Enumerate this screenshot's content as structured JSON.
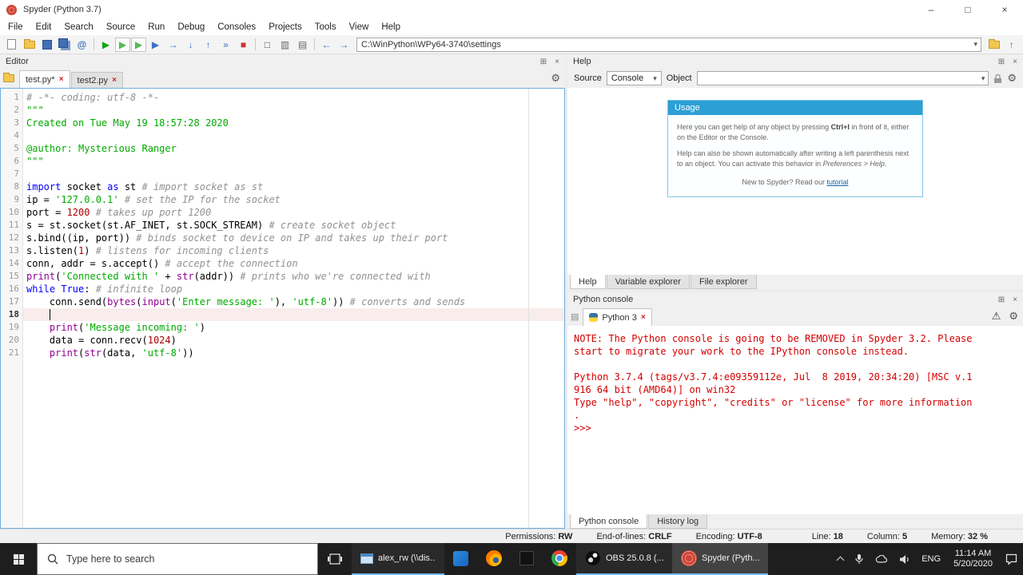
{
  "window": {
    "title": "Spyder (Python 3.7)",
    "controls": {
      "minimize": "–",
      "maximize": "□",
      "close": "×"
    }
  },
  "menu": [
    "File",
    "Edit",
    "Search",
    "Source",
    "Run",
    "Debug",
    "Consoles",
    "Projects",
    "Tools",
    "View",
    "Help"
  ],
  "toolbar": {
    "buttons": [
      {
        "name": "new-file-button",
        "icon": "new-file-icon",
        "cls": "ic-page"
      },
      {
        "name": "open-file-button",
        "icon": "open-folder-icon",
        "cls": "ic-folder"
      },
      {
        "name": "save-button",
        "icon": "save-icon",
        "cls": "ic-save"
      },
      {
        "name": "save-all-button",
        "icon": "save-all-icon",
        "cls": "ic-save ic-save2"
      },
      {
        "name": "find-symbols-button",
        "icon": "at-icon",
        "glyph": "@",
        "color": "#2d6fb5",
        "bold": true
      },
      {
        "sep": true
      },
      {
        "name": "run-file-button",
        "icon": "run-icon",
        "glyph": "▶",
        "color": "#13a813"
      },
      {
        "name": "run-cell-button",
        "icon": "run-cell-icon",
        "glyph": "▶",
        "color": "#55b855",
        "boxed": true
      },
      {
        "name": "run-cell-advance-button",
        "icon": "run-cell-advance-icon",
        "glyph": "▶",
        "color": "#55b855",
        "boxed": true
      },
      {
        "name": "debug-button",
        "icon": "debug-icon",
        "glyph": "▶",
        "color": "#3d70c9"
      },
      {
        "name": "step-over-button",
        "icon": "step-over-icon",
        "glyph": "→",
        "color": "#3d70c9"
      },
      {
        "name": "step-into-button",
        "icon": "step-into-icon",
        "glyph": "↓",
        "color": "#3d70c9"
      },
      {
        "name": "step-return-button",
        "icon": "step-return-icon",
        "glyph": "↑",
        "color": "#3d70c9"
      },
      {
        "name": "continue-button",
        "icon": "continue-icon",
        "glyph": "»",
        "color": "#3d70c9"
      },
      {
        "name": "stop-button",
        "icon": "stop-icon",
        "glyph": "■",
        "color": "#cc3333"
      },
      {
        "sep": true
      },
      {
        "name": "maximize-pane-button",
        "icon": "maximize-pane-icon",
        "glyph": "□",
        "color": "#555555"
      },
      {
        "name": "split-vertical-button",
        "icon": "split-vertical-icon",
        "glyph": "▥",
        "color": "#666666"
      },
      {
        "name": "split-horizontal-button",
        "icon": "split-horizontal-icon",
        "glyph": "▤",
        "color": "#666666"
      },
      {
        "sep": true
      },
      {
        "name": "back-button",
        "icon": "back-arrow-icon",
        "glyph": "←",
        "color": "#2d6fb5"
      },
      {
        "name": "forward-button",
        "icon": "forward-arrow-icon",
        "glyph": "→",
        "color": "#2d6fb5"
      }
    ],
    "path_value": "C:\\WinPython\\WPy64-3740\\settings",
    "right_buttons": [
      {
        "name": "browse-directory-button",
        "icon": "folder-icon",
        "cls": "ic-folder"
      },
      {
        "name": "parent-directory-button",
        "icon": "folder-up-icon",
        "glyph": "↑",
        "color": "#666666"
      }
    ]
  },
  "editor": {
    "pane_title": "Editor",
    "tabs": [
      {
        "label": "test.py*",
        "active": true
      },
      {
        "label": "test2.py",
        "active": false
      }
    ],
    "cursor": {
      "line": 18,
      "col": 4
    },
    "lines": [
      [
        [
          "c",
          "# -*- coding: utf-8 -*-"
        ]
      ],
      [
        [
          "s",
          "\"\"\""
        ]
      ],
      [
        [
          "s",
          "Created on Tue May 19 18:57:28 2020"
        ]
      ],
      [],
      [
        [
          "s",
          "@author: Mysterious Ranger"
        ]
      ],
      [
        [
          "s",
          "\"\"\""
        ]
      ],
      [],
      [
        [
          "k",
          "import"
        ],
        [
          "t",
          " socket "
        ],
        [
          "k",
          "as"
        ],
        [
          "t",
          " st "
        ],
        [
          "c",
          "# import socket as st"
        ]
      ],
      [
        [
          "t",
          "ip = "
        ],
        [
          "s",
          "'127.0.0.1'"
        ],
        [
          "t",
          " "
        ],
        [
          "c",
          "# set the IP for the socket"
        ]
      ],
      [
        [
          "t",
          "port = "
        ],
        [
          "n",
          "1200"
        ],
        [
          "t",
          " "
        ],
        [
          "c",
          "# takes up port 1200"
        ]
      ],
      [
        [
          "t",
          "s = st.socket(st.AF_INET, st.SOCK_STREAM) "
        ],
        [
          "c",
          "# create socket object"
        ]
      ],
      [
        [
          "t",
          "s.bind((ip, port)) "
        ],
        [
          "c",
          "# binds socket to device on IP and takes up their port"
        ]
      ],
      [
        [
          "t",
          "s.listen("
        ],
        [
          "n",
          "1"
        ],
        [
          "t",
          ") "
        ],
        [
          "c",
          "# listens for incoming clients"
        ]
      ],
      [
        [
          "t",
          "conn, addr = s.accept() "
        ],
        [
          "c",
          "# accept the connection"
        ]
      ],
      [
        [
          "b",
          "print"
        ],
        [
          "t",
          "("
        ],
        [
          "s",
          "'Connected with '"
        ],
        [
          "t",
          " + "
        ],
        [
          "b",
          "str"
        ],
        [
          "t",
          "(addr)) "
        ],
        [
          "c",
          "# prints who we're connected with"
        ]
      ],
      [
        [
          "k",
          "while"
        ],
        [
          "t",
          " "
        ],
        [
          "k",
          "True"
        ],
        [
          "t",
          ": "
        ],
        [
          "c",
          "# infinite loop"
        ]
      ],
      [
        [
          "t",
          "    conn.send("
        ],
        [
          "b",
          "bytes"
        ],
        [
          "t",
          "("
        ],
        [
          "b",
          "input"
        ],
        [
          "t",
          "("
        ],
        [
          "s",
          "'Enter message: '"
        ],
        [
          "t",
          "), "
        ],
        [
          "s",
          "'utf-8'"
        ],
        [
          "t",
          ")) "
        ],
        [
          "c",
          "# converts and sends"
        ]
      ],
      [
        [
          "t",
          "    "
        ]
      ],
      [
        [
          "t",
          "    "
        ],
        [
          "b",
          "print"
        ],
        [
          "t",
          "("
        ],
        [
          "s",
          "'Message incoming: '"
        ],
        [
          "t",
          ")"
        ]
      ],
      [
        [
          "t",
          "    data = conn.recv("
        ],
        [
          "n",
          "1024"
        ],
        [
          "t",
          ")"
        ]
      ],
      [
        [
          "t",
          "    "
        ],
        [
          "b",
          "print"
        ],
        [
          "t",
          "("
        ],
        [
          "b",
          "str"
        ],
        [
          "t",
          "(data, "
        ],
        [
          "s",
          "'utf-8'"
        ],
        [
          "t",
          "))"
        ]
      ]
    ]
  },
  "help": {
    "pane_title": "Help",
    "source_label": "Source",
    "source_value": "Console",
    "object_label": "Object",
    "object_value": "",
    "usage": {
      "title": "Usage",
      "p1_pre": "Here you can get help of any object by pressing ",
      "p1_kbd": "Ctrl+I",
      "p1_post": " in front of it, either on the Editor or the Console.",
      "p2_pre": "Help can also be shown automatically after writing a left parenthesis next to an object. You can activate this behavior in ",
      "p2_em": "Preferences > Help",
      "p2_post": ".",
      "p3_pre": "New to Spyder? Read our ",
      "p3_link": "tutorial"
    },
    "bottom_tabs": [
      "Help",
      "Variable explorer",
      "File explorer"
    ]
  },
  "console": {
    "pane_title": "Python console",
    "tab_label": "Python 3",
    "lines": [
      "NOTE: The Python console is going to be REMOVED in Spyder 3.2. Please",
      "start to migrate your work to the IPython console instead.",
      "",
      "Python 3.7.4 (tags/v3.7.4:e09359112e, Jul  8 2019, 20:34:20) [MSC v.1",
      "916 64 bit (AMD64)] on win32",
      "Type \"help\", \"copyright\", \"credits\" or \"license\" for more information",
      ".",
      ">>>"
    ],
    "bottom_tabs": [
      "Python console",
      "History log"
    ]
  },
  "statusbar": {
    "items": [
      {
        "label": "Permissions:",
        "value": "RW"
      },
      {
        "label": "End-of-lines:",
        "value": "CRLF"
      },
      {
        "label": "Encoding:",
        "value": "UTF-8"
      },
      {
        "label": "Line:",
        "value": "18",
        "gap_before": true
      },
      {
        "label": "Column:",
        "value": "5"
      },
      {
        "label": "Memory:",
        "value": "32 %"
      }
    ]
  },
  "taskbar": {
    "search_placeholder": "Type here to search",
    "apps": [
      {
        "name": "explorer-window",
        "icon": "window",
        "label": "alex_rw (\\\\dis...",
        "running": true
      },
      {
        "name": "blue-app",
        "icon": "blue",
        "running": false
      },
      {
        "name": "firefox",
        "icon": "firefox",
        "running": false
      },
      {
        "name": "dark-app",
        "icon": "dark",
        "running": false
      },
      {
        "name": "chrome",
        "icon": "chrome",
        "running": false
      },
      {
        "name": "obs",
        "icon": "obs",
        "label": "OBS 25.0.8 (...",
        "running": true
      },
      {
        "name": "spyder",
        "icon": "spyder",
        "label": "Spyder (Pyth...",
        "running": true,
        "active": true
      }
    ],
    "tray": {
      "lang": "ENG",
      "time": "11:14 AM",
      "date": "5/20/2020"
    }
  },
  "colors": {
    "accent_blue": "#2c9fd4",
    "console_text": "#d40000",
    "syntax_keyword": "#0000ff",
    "syntax_builtin": "#900090",
    "syntax_string": "#00aa00",
    "syntax_number": "#aa0000",
    "syntax_comment": "#919191",
    "run_green": "#13a813",
    "stop_red": "#cc3333",
    "current_line_bg": "#f8ecec",
    "taskbar_bg": "#1e1e1e"
  }
}
